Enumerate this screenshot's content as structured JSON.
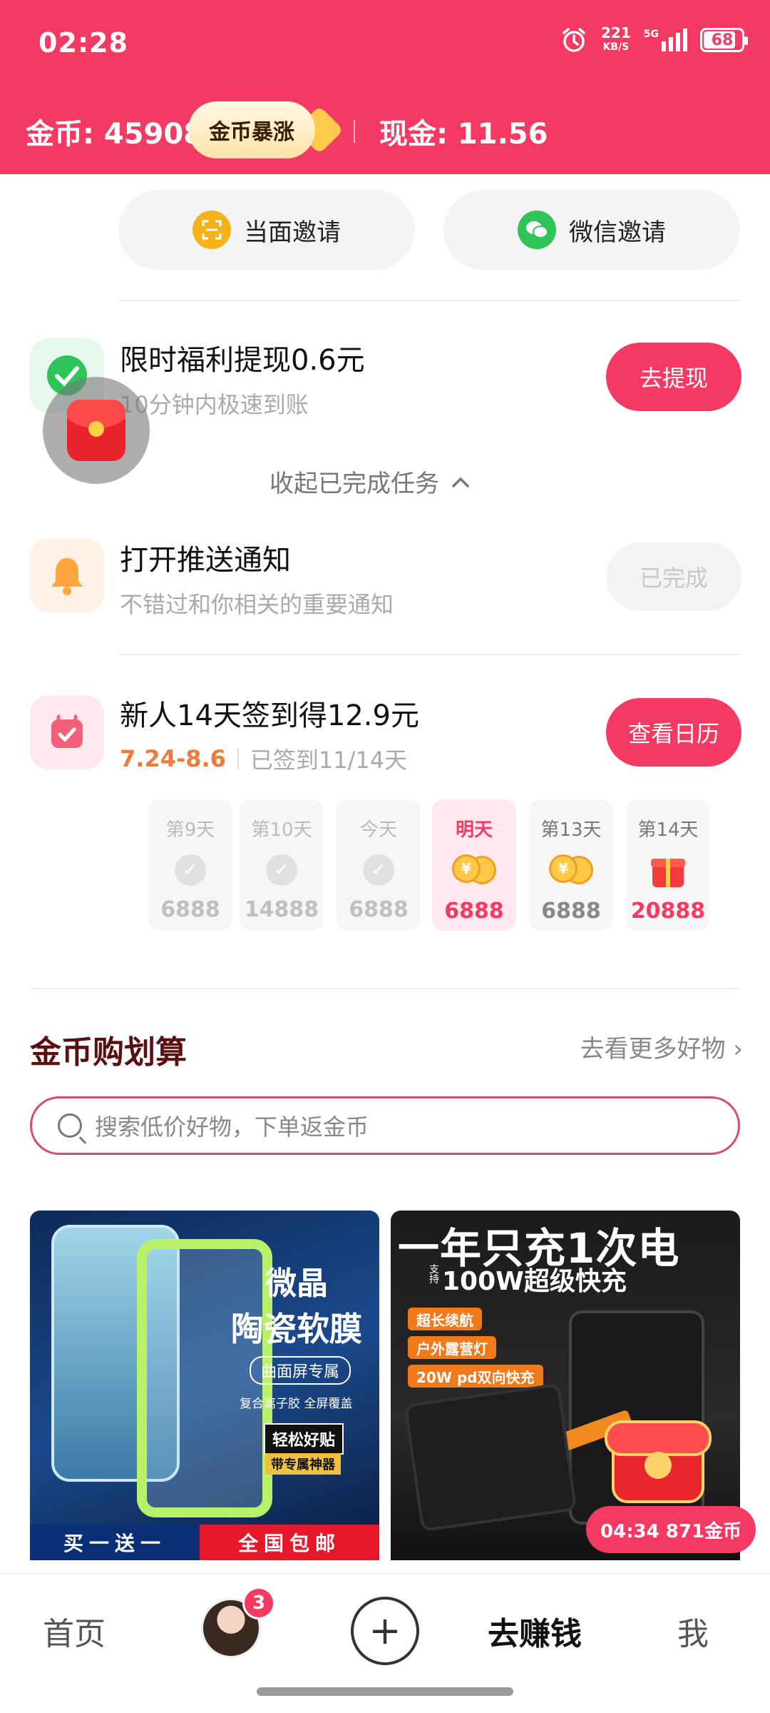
{
  "status_bar": {
    "time": "02:28",
    "net_speed_value": "221",
    "net_speed_unit": "KB/S",
    "network": "5G",
    "battery": "68"
  },
  "header": {
    "coins": "金币: 45908",
    "boost_label": "金币暴涨",
    "cash": "现金: 11.56",
    "bg_color": "#f43a63"
  },
  "invite": {
    "face_label": "当面邀请",
    "wechat_label": "微信邀请"
  },
  "tasks": [
    {
      "title": "限时福利提现0.6元",
      "subtitle": "10分钟内极速到账",
      "button": "去提现"
    },
    {
      "title": "打开推送通知",
      "subtitle": "不错过和你相关的重要通知",
      "button": "已完成"
    },
    {
      "title": "新人14天签到得12.9元",
      "subtitle_dates": "7.24-8.6",
      "subtitle_progress": "已签到11/14天",
      "button": "查看日历"
    }
  ],
  "collapse_label": "收起已完成任务",
  "signin_days": [
    {
      "label": "第9天",
      "value": "6888",
      "state": "done"
    },
    {
      "label": "第10天",
      "value": "14888",
      "state": "done"
    },
    {
      "label": "今天",
      "value": "6888",
      "state": "done"
    },
    {
      "label": "明天",
      "value": "6888",
      "state": "next"
    },
    {
      "label": "第13天",
      "value": "6888",
      "state": "future"
    },
    {
      "label": "第14天",
      "value": "20888",
      "state": "gift"
    }
  ],
  "section": {
    "title": "金币购划算",
    "more": "去看更多好物 ›",
    "search_placeholder": "搜索低价好物，下单返金币"
  },
  "products": [
    {
      "line1": "微晶",
      "line2": "陶瓷软膜",
      "tag": "曲面屏专属",
      "small": "复合离子胶 全屏覆盖",
      "tag2": "轻松好贴",
      "tag3": "带专属神器",
      "ribbon_left": "买一送一",
      "ribbon_right": "全国包邮"
    },
    {
      "headline": "一年只充1次电",
      "support": "支持",
      "sub": "100W超级快充",
      "tags": [
        "超长续航",
        "户外露营灯",
        "20W pd双向快充"
      ]
    }
  ],
  "timer_pill": "04:34 871金币",
  "bottom_nav": {
    "home": "首页",
    "badge": "3",
    "earn": "去赚钱",
    "me": "我"
  }
}
